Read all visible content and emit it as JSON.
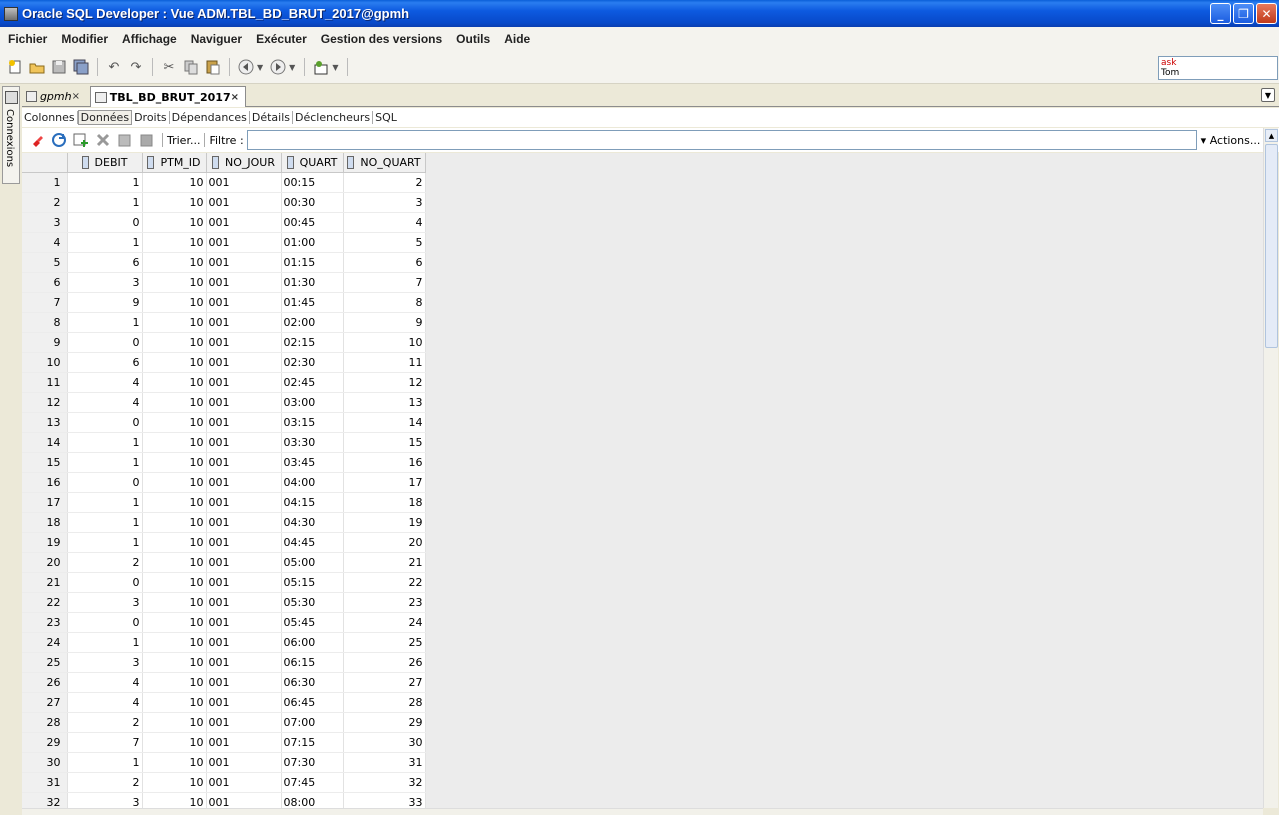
{
  "window": {
    "title": "Oracle SQL Developer : Vue ADM.TBL_BD_BRUT_2017@gpmh"
  },
  "menu": [
    "Fichier",
    "Modifier",
    "Affichage",
    "Naviguer",
    "Exécuter",
    "Gestion des versions",
    "Outils",
    "Aide"
  ],
  "ask": {
    "line1": "ask",
    "line2": "Tom"
  },
  "sidetab": {
    "label": "Connexions"
  },
  "tabs": [
    {
      "label": "gpmh",
      "close": "×"
    },
    {
      "label": "TBL_BD_BRUT_2017",
      "close": "×"
    }
  ],
  "subtabs": [
    "Colonnes",
    "Données",
    "Droits",
    "Dépendances",
    "Détails",
    "Déclencheurs",
    "SQL"
  ],
  "datatoolbar": {
    "sort_label": "Trier...",
    "filter_label": "Filtre :",
    "filter_value": "",
    "actions_label": "Actions..."
  },
  "columns": [
    "DEBIT",
    "PTM_ID",
    "NO_JOUR",
    "QUART",
    "NO_QUART"
  ],
  "rows": [
    [
      "1",
      "1",
      "10",
      "001",
      "00:15",
      "2"
    ],
    [
      "2",
      "1",
      "10",
      "001",
      "00:30",
      "3"
    ],
    [
      "3",
      "0",
      "10",
      "001",
      "00:45",
      "4"
    ],
    [
      "4",
      "1",
      "10",
      "001",
      "01:00",
      "5"
    ],
    [
      "5",
      "6",
      "10",
      "001",
      "01:15",
      "6"
    ],
    [
      "6",
      "3",
      "10",
      "001",
      "01:30",
      "7"
    ],
    [
      "7",
      "9",
      "10",
      "001",
      "01:45",
      "8"
    ],
    [
      "8",
      "1",
      "10",
      "001",
      "02:00",
      "9"
    ],
    [
      "9",
      "0",
      "10",
      "001",
      "02:15",
      "10"
    ],
    [
      "10",
      "6",
      "10",
      "001",
      "02:30",
      "11"
    ],
    [
      "11",
      "4",
      "10",
      "001",
      "02:45",
      "12"
    ],
    [
      "12",
      "4",
      "10",
      "001",
      "03:00",
      "13"
    ],
    [
      "13",
      "0",
      "10",
      "001",
      "03:15",
      "14"
    ],
    [
      "14",
      "1",
      "10",
      "001",
      "03:30",
      "15"
    ],
    [
      "15",
      "1",
      "10",
      "001",
      "03:45",
      "16"
    ],
    [
      "16",
      "0",
      "10",
      "001",
      "04:00",
      "17"
    ],
    [
      "17",
      "1",
      "10",
      "001",
      "04:15",
      "18"
    ],
    [
      "18",
      "1",
      "10",
      "001",
      "04:30",
      "19"
    ],
    [
      "19",
      "1",
      "10",
      "001",
      "04:45",
      "20"
    ],
    [
      "20",
      "2",
      "10",
      "001",
      "05:00",
      "21"
    ],
    [
      "21",
      "0",
      "10",
      "001",
      "05:15",
      "22"
    ],
    [
      "22",
      "3",
      "10",
      "001",
      "05:30",
      "23"
    ],
    [
      "23",
      "0",
      "10",
      "001",
      "05:45",
      "24"
    ],
    [
      "24",
      "1",
      "10",
      "001",
      "06:00",
      "25"
    ],
    [
      "25",
      "3",
      "10",
      "001",
      "06:15",
      "26"
    ],
    [
      "26",
      "4",
      "10",
      "001",
      "06:30",
      "27"
    ],
    [
      "27",
      "4",
      "10",
      "001",
      "06:45",
      "28"
    ],
    [
      "28",
      "2",
      "10",
      "001",
      "07:00",
      "29"
    ],
    [
      "29",
      "7",
      "10",
      "001",
      "07:15",
      "30"
    ],
    [
      "30",
      "1",
      "10",
      "001",
      "07:30",
      "31"
    ],
    [
      "31",
      "2",
      "10",
      "001",
      "07:45",
      "32"
    ],
    [
      "32",
      "3",
      "10",
      "001",
      "08:00",
      "33"
    ]
  ]
}
